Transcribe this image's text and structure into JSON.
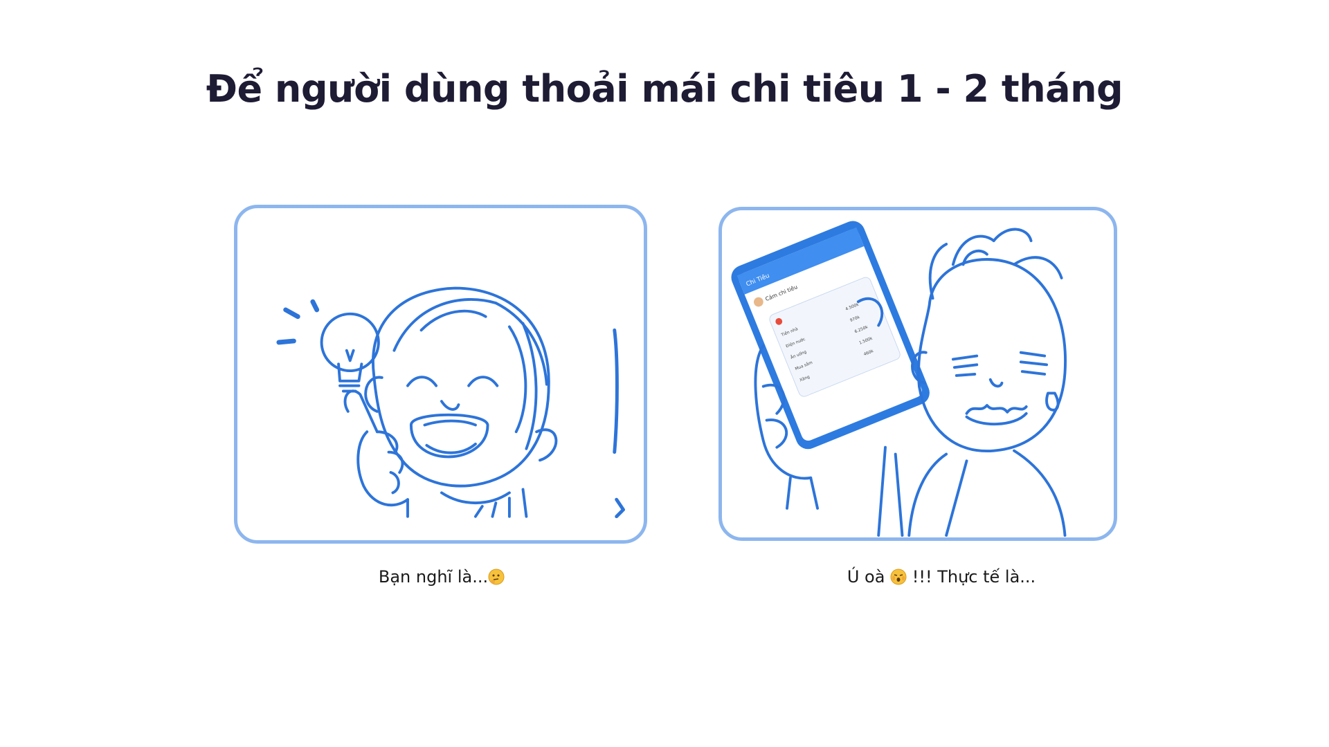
{
  "page": {
    "title": "Để người dùng thoải mái chi tiêu 1 - 2 tháng"
  },
  "illustrations": {
    "left": {
      "caption": "Bạn nghĩ là...",
      "caption_emoji": "thinking-face-emoji"
    },
    "right": {
      "caption_prefix": "Ú oà",
      "caption_emoji": "hushed-face-emoji",
      "caption_suffix": "!!! Thực tế là...",
      "phone_screen": {
        "header": "Chi Tiêu",
        "section_title": "Cảm chi tiêu",
        "rows": [
          {
            "label": "Tiền nhà",
            "value": "4.500k"
          },
          {
            "label": "Điện nước",
            "value": "970k"
          },
          {
            "label": "Ăn uống",
            "value": "6.250k"
          },
          {
            "label": "Mua sắm",
            "value": "1.500k"
          },
          {
            "label": "Xăng",
            "value": "460k"
          }
        ]
      }
    }
  },
  "colors": {
    "title": "#1e1b34",
    "card_border": "#8db6ee",
    "sketch": "#2d74d9",
    "phone_screen_header": "#3f8ef0"
  }
}
